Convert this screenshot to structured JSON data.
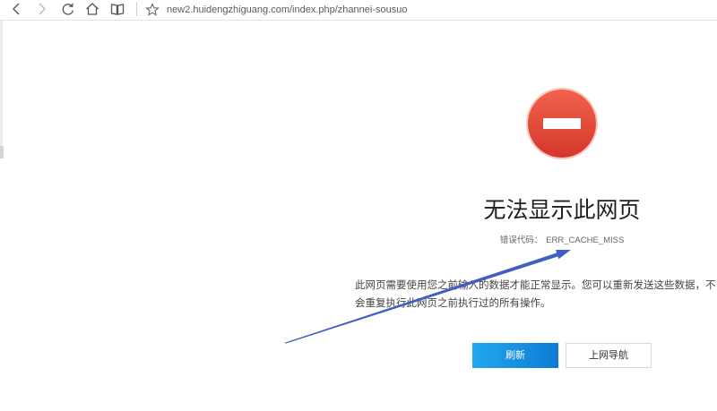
{
  "browser": {
    "url": "new2.huidengzhiguang.com/index.php/zhannei-sousuo",
    "icons": {
      "back": "back-icon",
      "forward": "forward-icon",
      "refresh": "refresh-icon",
      "home": "home-icon",
      "reading_view": "book-icon",
      "favorite": "star-icon"
    }
  },
  "error": {
    "icon": "error-minus-icon",
    "title": "无法显示此网页",
    "code_label": "错误代码：",
    "code": "ERR_CACHE_MISS",
    "message_lines": [
      "此网页需要使用您之前输入的数据才能正常显示。您可以重新发送这些数据，不",
      "会重复执行此网页之前执行过的所有操作。"
    ]
  },
  "buttons": {
    "refresh": "刷新",
    "navigate": "上网导航"
  },
  "colors": {
    "error_red": "#e0473a",
    "button_blue": "#1490e0",
    "annotation_arrow": "#3f5fc2",
    "text_dark": "#1f1f1f"
  }
}
